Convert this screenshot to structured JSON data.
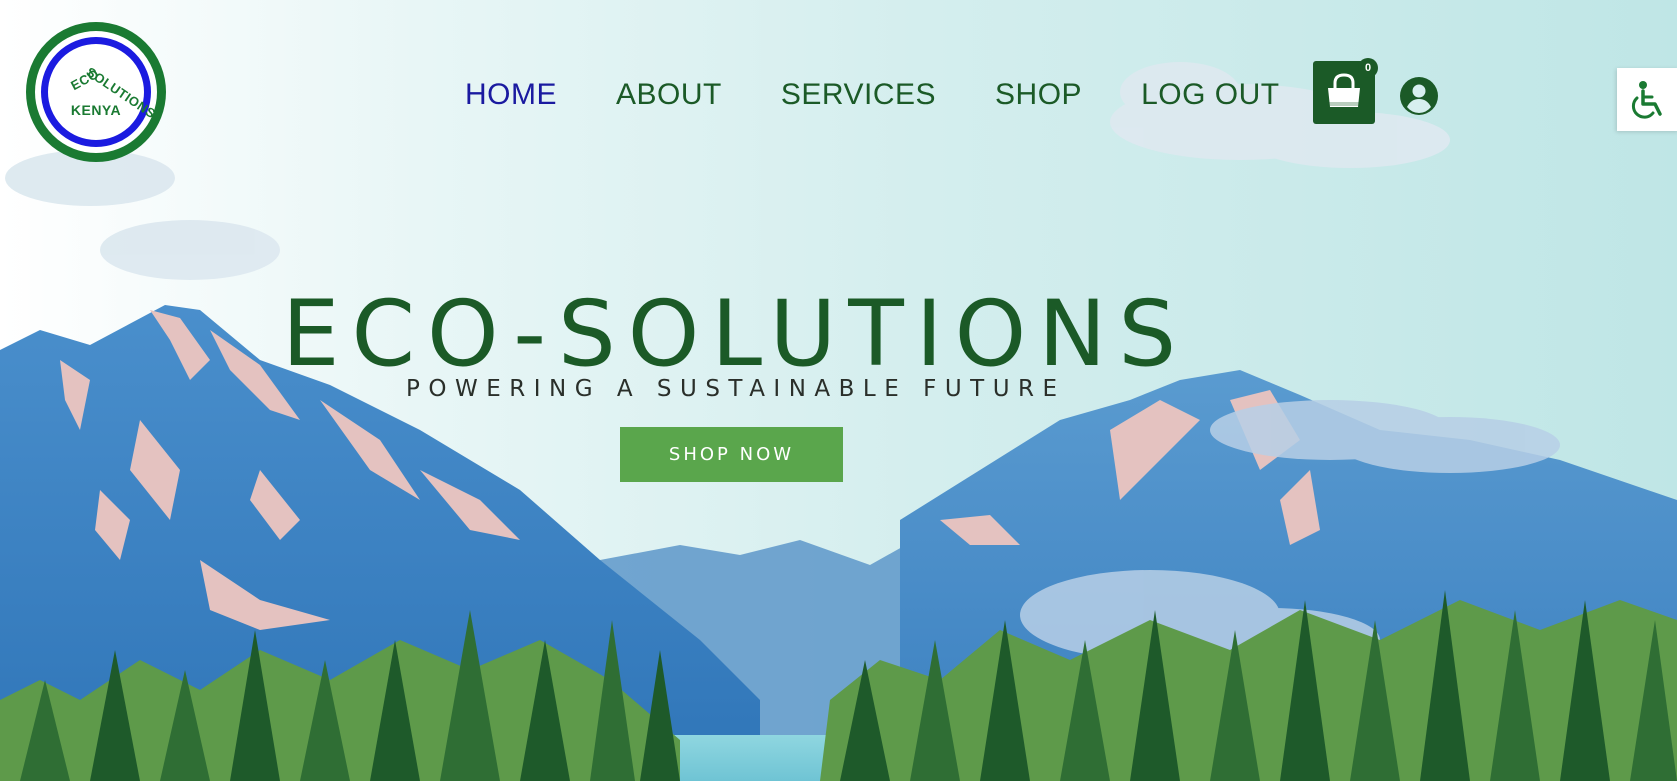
{
  "logo": {
    "top_text": "ECO SOLUTIONS",
    "word_eco": "ECO",
    "word_solutions": "SOLUTIONS",
    "bottom_text": "KENYA"
  },
  "nav": {
    "items": [
      {
        "label": "HOME",
        "active": true
      },
      {
        "label": "ABOUT",
        "active": false
      },
      {
        "label": "SERVICES",
        "active": false
      },
      {
        "label": "SHOP",
        "active": false
      },
      {
        "label": "LOG OUT",
        "active": false
      }
    ]
  },
  "cart": {
    "count": "0",
    "icon": "shopping-bag-icon"
  },
  "account": {
    "icon": "user-circle-icon"
  },
  "accessibility": {
    "icon": "wheelchair-icon"
  },
  "hero": {
    "title": "ECO-SOLUTIONS",
    "tagline": "POWERING A SUSTAINABLE FUTURE",
    "cta_label": "SHOP NOW"
  },
  "colors": {
    "brand_green": "#1b5a27",
    "active_nav": "#1a1aa0",
    "cta_green": "#5aa64c",
    "logo_blue": "#1b1be0"
  }
}
